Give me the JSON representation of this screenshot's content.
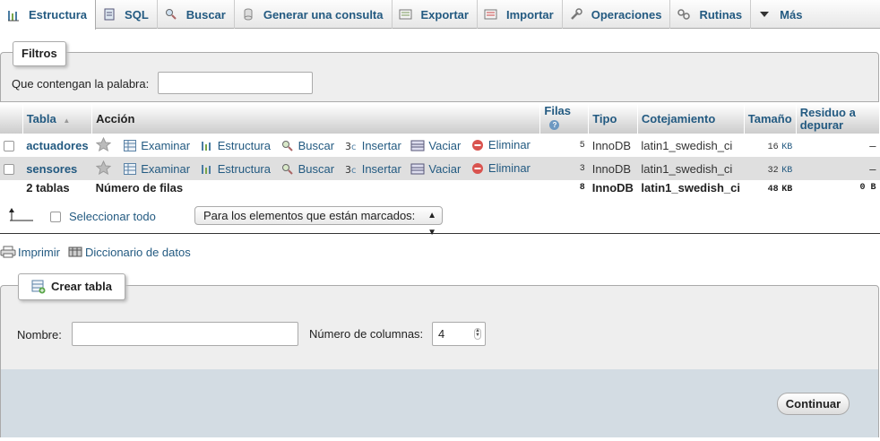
{
  "tabs": [
    {
      "label": "Estructura",
      "icon": "structure-icon",
      "active": true
    },
    {
      "label": "SQL",
      "icon": "sql-icon"
    },
    {
      "label": "Buscar",
      "icon": "search-icon"
    },
    {
      "label": "Generar una consulta",
      "icon": "query-icon"
    },
    {
      "label": "Exportar",
      "icon": "export-icon"
    },
    {
      "label": "Importar",
      "icon": "import-icon"
    },
    {
      "label": "Operaciones",
      "icon": "wrench-icon"
    },
    {
      "label": "Rutinas",
      "icon": "routines-icon"
    },
    {
      "label": "Más",
      "icon": "triangle-down-icon"
    }
  ],
  "filters": {
    "legend": "Filtros",
    "label": "Que contengan la palabra:",
    "value": ""
  },
  "table": {
    "headers": {
      "tabla": "Tabla",
      "accion": "Acción",
      "filas": "Filas",
      "tipo": "Tipo",
      "cotejamiento": "Cotejamiento",
      "tamano": "Tamaño",
      "residuo": "Residuo a depurar"
    },
    "actions": [
      "Examinar",
      "Estructura",
      "Buscar",
      "Insertar",
      "Vaciar",
      "Eliminar"
    ],
    "rows": [
      {
        "name": "actuadores",
        "rows": "5",
        "type": "InnoDB",
        "collation": "latin1_swedish_ci",
        "size": "16",
        "size_unit": "KB",
        "overhead": "–"
      },
      {
        "name": "sensores",
        "rows": "3",
        "type": "InnoDB",
        "collation": "latin1_swedish_ci",
        "size": "32",
        "size_unit": "KB",
        "overhead": "–"
      }
    ],
    "footer": {
      "count": "2 tablas",
      "label": "Número de filas",
      "rows": "8",
      "type": "InnoDB",
      "collation": "latin1_swedish_ci",
      "size": "48",
      "size_unit": "KB",
      "overhead": "0 B"
    }
  },
  "select_all": {
    "label": "Seleccionar todo",
    "dropdown": "Para los elementos que están marcados:"
  },
  "links": {
    "print": "Imprimir",
    "dictionary": "Diccionario de datos"
  },
  "create_table": {
    "legend": "Crear tabla",
    "name_label": "Nombre:",
    "name_value": "",
    "columns_label": "Número de columnas:",
    "columns_value": "4",
    "submit": "Continuar"
  },
  "colors": {
    "link": "#235a81",
    "panel": "#eeeeee",
    "footer": "#d3dce3"
  }
}
